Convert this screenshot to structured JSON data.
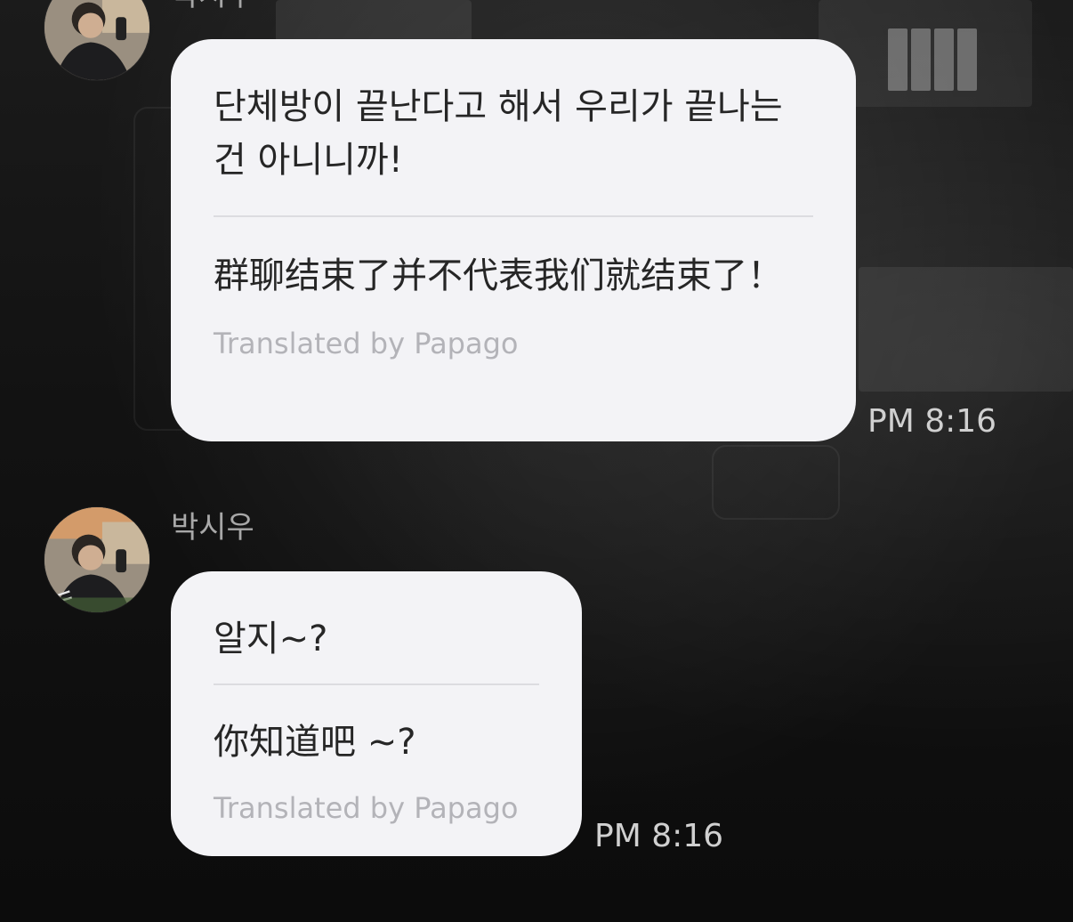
{
  "messages": [
    {
      "sender": "박시우",
      "original": "단체방이 끝난다고 해서 우리가 끝나는 건 아니니까!",
      "translation": "群聊结束了并不代表我们就结束了！",
      "credit": "Translated by Papago",
      "time": "PM 8:16"
    },
    {
      "sender": "박시우",
      "original": "알지~?",
      "translation": "你知道吧 ~?",
      "credit": "Translated by Papago",
      "time": "PM 8:16"
    }
  ],
  "colors": {
    "bubble": "#f3f3f6",
    "bubble_text": "#262626",
    "credit_text": "#b3b3b8",
    "timestamp": "#d0d0d0",
    "sender_name": "#a8a8a8",
    "background": "#0d0d0d"
  }
}
